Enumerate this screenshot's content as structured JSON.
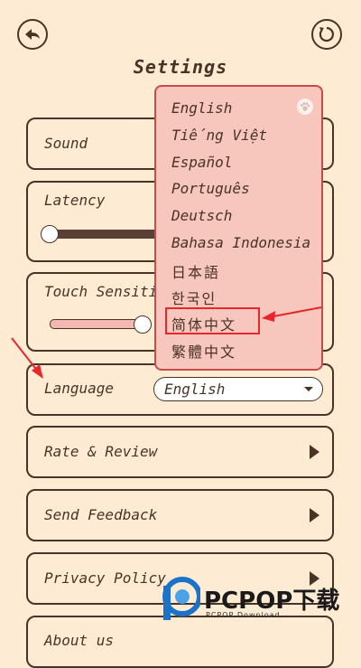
{
  "header": {
    "title": "Settings",
    "back_icon": "back-arrow-icon",
    "reset_icon": "reset-icon"
  },
  "sections": {
    "sound": {
      "label": "Sound"
    },
    "latency": {
      "label": "Latency",
      "level": 0.4
    },
    "touch": {
      "label": "Touch Sensitivity",
      "level": 0.8
    },
    "language": {
      "label": "Language",
      "selected": "English"
    },
    "rate": {
      "label": "Rate & Review"
    },
    "feedback": {
      "label": "Send Feedback"
    },
    "privacy": {
      "label": "Privacy Policy"
    },
    "about": {
      "label": "About us"
    }
  },
  "language_menu": {
    "options": [
      "English",
      "Tiếng Việt",
      "Español",
      "Português",
      "Deutsch",
      "Bahasa Indonesia",
      "日本語",
      "한국인",
      "简体中文",
      "繁體中文"
    ],
    "highlighted": "简体中文"
  },
  "watermark": {
    "brand": "PCPOP下载",
    "sub": "PCPOP Download"
  },
  "colors": {
    "background": "#fdebd3",
    "ink": "#4a3326",
    "menu": "#f7c6bc",
    "annotation": "#e8262b"
  }
}
